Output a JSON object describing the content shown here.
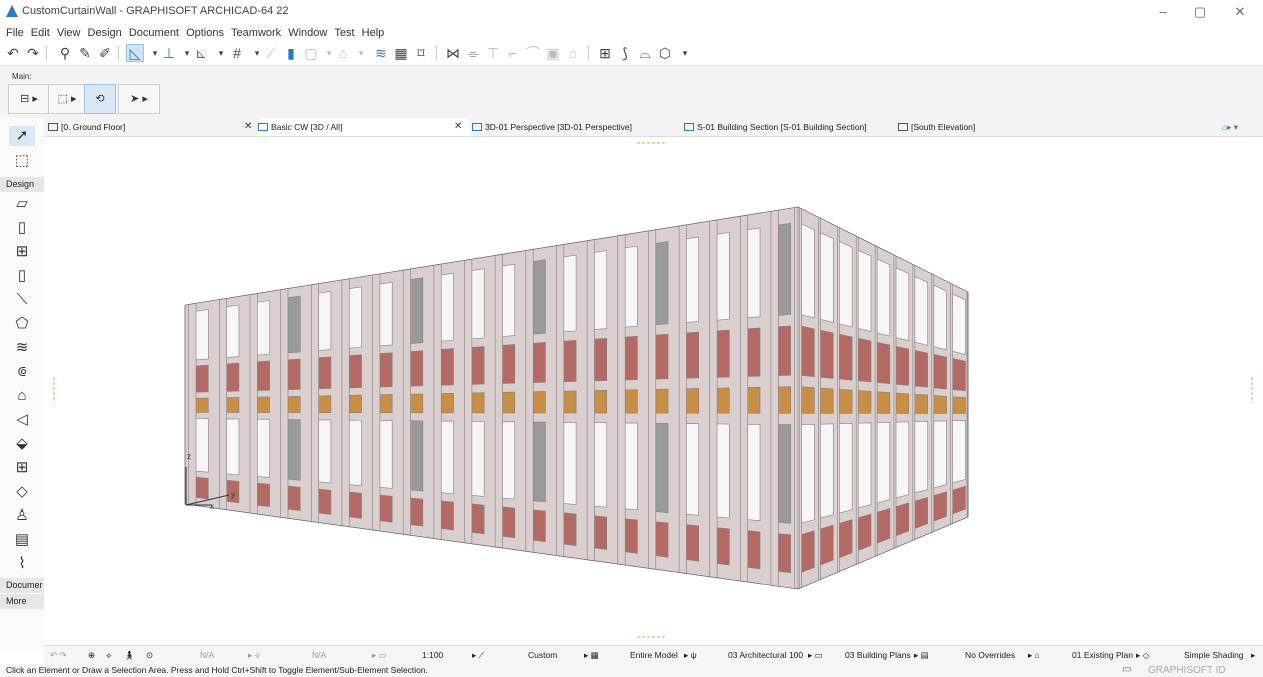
{
  "window": {
    "title": "CustomCurtainWall - GRAPHISOFT ARCHICAD-64 22",
    "controls": [
      "–",
      "▢",
      "✕"
    ]
  },
  "menu": [
    "File",
    "Edit",
    "View",
    "Design",
    "Document",
    "Options",
    "Teamwork",
    "Window",
    "Test",
    "Help"
  ],
  "infobox": {
    "main_label": "Main:"
  },
  "toolbox": {
    "design_label": "Design",
    "document_label": "Documer",
    "more_label": "More"
  },
  "tabs": [
    {
      "label": "[0. Ground Floor]",
      "active": false
    },
    {
      "label": "Basic CW [3D / All]",
      "active": true
    },
    {
      "label": "3D-01 Perspective [3D-01 Perspective]",
      "active": false
    },
    {
      "label": "S-01 Building Section [S-01 Building Section]",
      "active": false
    },
    {
      "label": "[South Elevation]",
      "active": false
    }
  ],
  "axes": {
    "z": "z",
    "x": "x",
    "y": "y"
  },
  "status": {
    "na1": "N/A",
    "na2": "N/A",
    "scale": "1:100",
    "layer_combo": "Custom",
    "model_view": "Entire Model",
    "pen_set": "03 Architectural 100",
    "mvo": "03 Building Plans",
    "overrides": "No Overrides",
    "renovation": "01 Existing Plan",
    "shading": "Simple Shading"
  },
  "help_text": "Click an Element or Draw a Selection Area. Press and Hold Ctrl+Shift to Toggle Element/Sub-Element Selection.",
  "brand": "GRAPHISOFT ID",
  "colors": {
    "accent": "#2b79c2",
    "frame": "#d9cfcf",
    "brick_panel": "#b46a64",
    "wood_panel": "#c98e45",
    "glass": "#f6f6f6",
    "concrete": "#9a9a9a"
  }
}
